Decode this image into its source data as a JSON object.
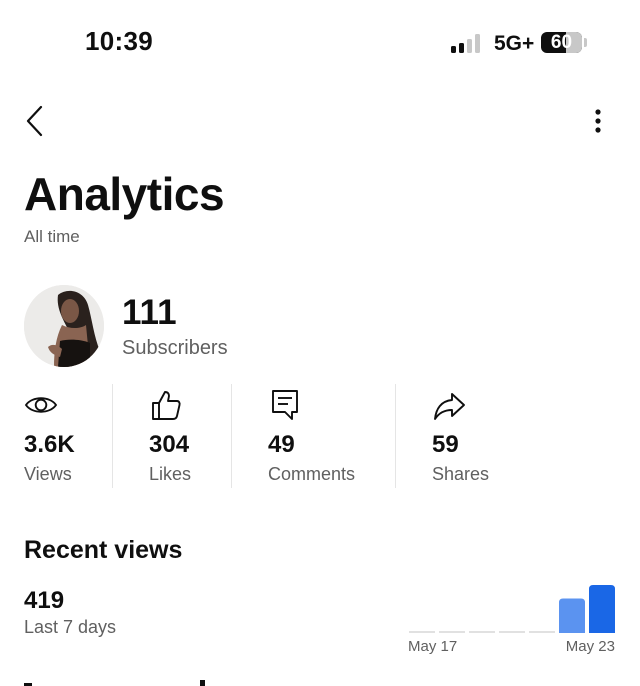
{
  "status_bar": {
    "time": "10:39",
    "network": "5G+",
    "battery_level": "60",
    "signal_bars_filled": 2,
    "signal_bars_total": 4
  },
  "header": {
    "back_icon": "chevron-left-icon",
    "more_icon": "vertical-ellipsis-icon",
    "title": "Analytics",
    "subtitle": "All time"
  },
  "channel": {
    "subscribers_count": "111",
    "subscribers_label": "Subscribers"
  },
  "metrics": [
    {
      "icon": "eye-icon",
      "value": "3.6K",
      "label": "Views"
    },
    {
      "icon": "thumbs-up-icon",
      "value": "304",
      "label": "Likes"
    },
    {
      "icon": "comment-icon",
      "value": "49",
      "label": "Comments"
    },
    {
      "icon": "share-arrow-icon",
      "value": "59",
      "label": "Shares"
    }
  ],
  "recent_views": {
    "title": "Recent views",
    "value": "419",
    "period_label": "Last 7 days"
  },
  "chart_data": {
    "type": "bar",
    "categories": [
      "",
      "",
      "",
      "",
      "",
      "",
      ""
    ],
    "x_tick_labels": [
      "May 17",
      "May 23"
    ],
    "values": [
      0,
      0,
      0,
      0,
      0,
      0.72,
      1.0
    ],
    "colors": {
      "zero": "#e1e1e1",
      "previous": "#5b93f0",
      "latest": "#1a67e6"
    },
    "title": "",
    "xlabel": "",
    "ylabel": ""
  },
  "colors": {
    "text_primary": "#0f0f0f",
    "text_secondary": "#606060",
    "accent_blue": "#1a67e6"
  }
}
